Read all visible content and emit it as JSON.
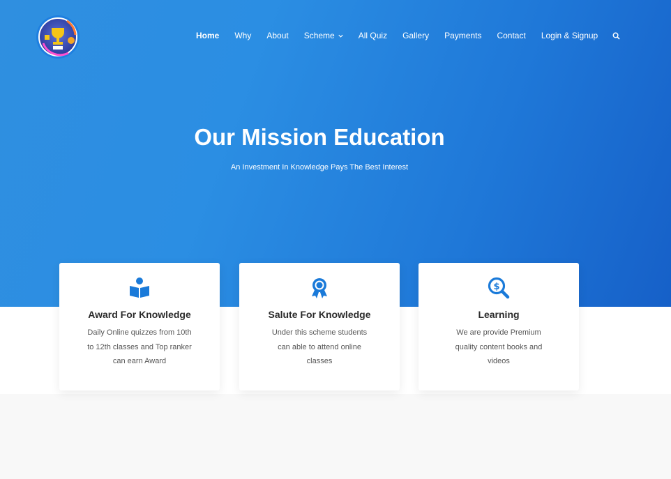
{
  "nav": {
    "items": [
      {
        "label": "Home",
        "name": "nav-home"
      },
      {
        "label": "Why",
        "name": "nav-why"
      },
      {
        "label": "About",
        "name": "nav-about"
      },
      {
        "label": "Scheme",
        "name": "nav-scheme"
      },
      {
        "label": "All Quiz",
        "name": "nav-all-quiz"
      },
      {
        "label": "Gallery",
        "name": "nav-gallery"
      },
      {
        "label": "Payments",
        "name": "nav-payments"
      },
      {
        "label": "Contact",
        "name": "nav-contact"
      },
      {
        "label": "Login & Signup",
        "name": "nav-login-signup"
      }
    ],
    "search_icon": "search-icon"
  },
  "hero": {
    "title": "Our Mission Education",
    "subtitle": "An Investment In Knowledge Pays The Best Interest"
  },
  "cards": [
    {
      "icon": "book-reader-icon",
      "title": "Award For Knowledge",
      "desc": "Daily Online quizzes from 10th to 12th classes and Top ranker can earn Award"
    },
    {
      "icon": "award-ribbon-icon",
      "title": "Salute For Knowledge",
      "desc": "Under this scheme students can able to attend online classes"
    },
    {
      "icon": "search-dollar-icon",
      "title": "Learning",
      "desc": "We are provide Premium quality content books and videos"
    }
  ],
  "colors": {
    "accent": "#1a7ad9",
    "hero_start": "#2f8fe0",
    "hero_end": "#1660c8"
  }
}
